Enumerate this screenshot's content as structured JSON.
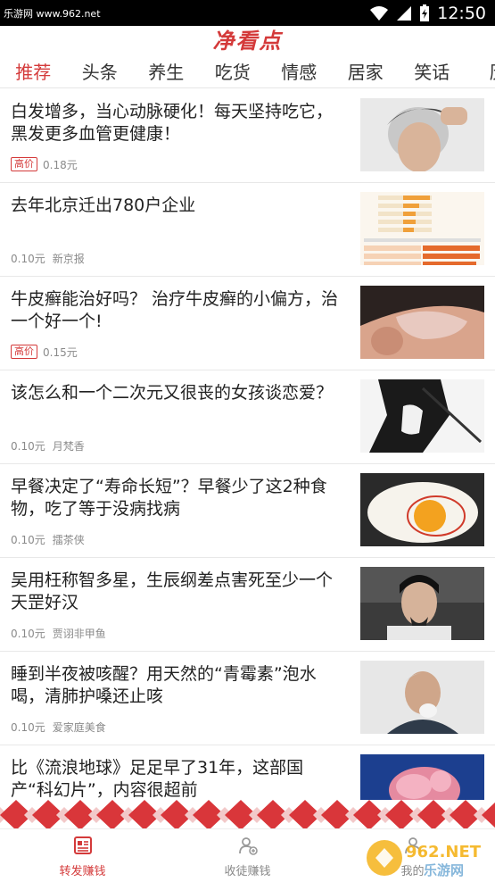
{
  "status_bar": {
    "site_label": "乐游网 www.962.net",
    "time": "12:50",
    "icons": [
      "wifi-icon",
      "signal-icon",
      "battery-charging-icon"
    ]
  },
  "app": {
    "title": "净看点",
    "accent_color": "#d43a3a"
  },
  "tabs": [
    {
      "label": "推荐",
      "active": true
    },
    {
      "label": "头条"
    },
    {
      "label": "养生"
    },
    {
      "label": "吃货"
    },
    {
      "label": "情感"
    },
    {
      "label": "居家"
    },
    {
      "label": "笑话"
    },
    {
      "label": "历"
    }
  ],
  "articles": [
    {
      "title": "白发增多，当心动脉硬化！每天坚持吃它，黑发更多血管更健康！",
      "badge": "高价",
      "price": "0.18元",
      "source": ""
    },
    {
      "title": "去年北京迁出780户企业",
      "badge": "",
      "price": "0.10元",
      "source": "新京报"
    },
    {
      "title": "牛皮癣能治好吗？ 治疗牛皮癣的小偏方，治一个好一个!",
      "badge": "高价",
      "price": "0.15元",
      "source": ""
    },
    {
      "title": "该怎么和一个二次元又很丧的女孩谈恋爱？",
      "badge": "",
      "price": "0.10元",
      "source": "月梵香"
    },
    {
      "title": "早餐决定了“寿命长短”？早餐少了这2种食物，吃了等于没病找病",
      "badge": "",
      "price": "0.10元",
      "source": "擂茶侠"
    },
    {
      "title": "吴用枉称智多星，生辰纲差点害死至少一个天罡好汉",
      "badge": "",
      "price": "0.10元",
      "source": "贾诩非甲鱼"
    },
    {
      "title": "睡到半夜被咳醒？用天然的“青霉素”泡水喝，清肺护嗓还止咳",
      "badge": "",
      "price": "0.10元",
      "source": "爱家庭美食"
    },
    {
      "title": "比《流浪地球》足足早了31年，这部国产“科幻片”，内容很超前",
      "badge": "",
      "price": "",
      "source": ""
    }
  ],
  "bottom_nav": [
    {
      "label": "转发赚钱",
      "active": true,
      "icon": "article-icon"
    },
    {
      "label": "收徒赚钱",
      "icon": "add-user-icon"
    },
    {
      "label": "我的",
      "icon": "profile-icon"
    }
  ],
  "watermark": {
    "line1": "962.NET",
    "line2": "乐游网"
  }
}
